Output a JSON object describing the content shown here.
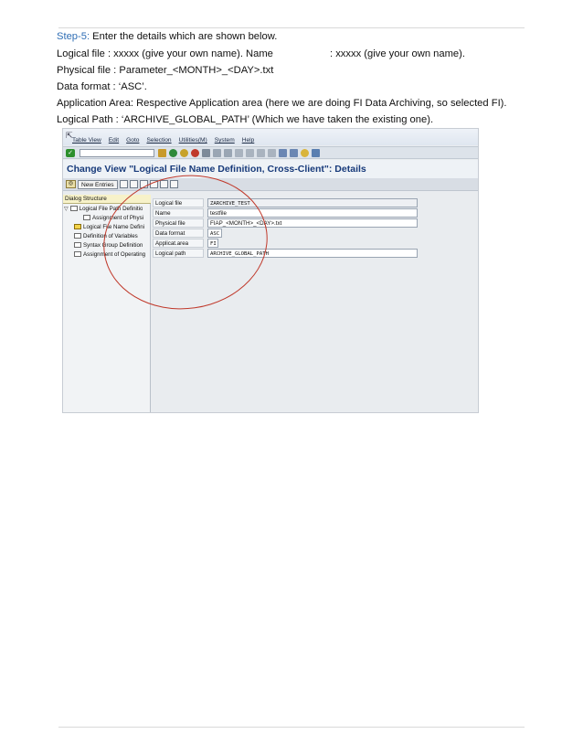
{
  "instructions": {
    "step_label": "Step-5:",
    "step_text": " Enter the details which are shown below.",
    "logical_file_line": "Logical file    : xxxxx (give your own name). Name",
    "name_value": ": xxxxx (give your own name).",
    "physical_file_line": "Physical file  : Parameter_<MONTH>_<DAY>.txt",
    "data_format_line": "Data format   : ‘ASC’.",
    "application_area_line": "Application Area: Respective Application area (here we are doing FI Data Archiving, so selected FI).",
    "logical_path_line": "Logical Path   : ‘ARCHIVE_GLOBAL_PATH’ (Which we have taken the existing one)."
  },
  "sap": {
    "menu": [
      "Table View",
      "Edit",
      "Goto",
      "Selection",
      "Utilities(M)",
      "System",
      "Help"
    ],
    "title": "Change View \"Logical File Name Definition, Cross-Client\": Details",
    "new_entries_label": "New Entries",
    "tree": {
      "header": "Dialog Structure",
      "items": [
        "Logical File Path Definitio",
        "Assignment of Physi",
        "Logical File Name Defini",
        "Definition of Variables",
        "Syntax Group Definition",
        "Assignment of Operating"
      ]
    },
    "fields": [
      {
        "label": "Logical file",
        "value": "ZARCHIVE_TEST"
      },
      {
        "label": "Name",
        "value": "testfile"
      },
      {
        "label": "Physical file",
        "value": "FIAP_<MONTH>_<DAY>.txt"
      },
      {
        "label": "Data format",
        "value": "ASC"
      },
      {
        "label": "Applicat.area",
        "value": "FI"
      },
      {
        "label": "Logical path",
        "value": "ARCHIVE_GLOBAL_PATH"
      }
    ],
    "colors": {
      "title": "#173a7a",
      "circle": "#c0392b",
      "ok_button": "#2d8f2d"
    },
    "icons": [
      "ok-check-icon",
      "save-icon",
      "back-icon",
      "exit-icon",
      "cancel-icon",
      "print-icon",
      "find-icon",
      "glasses-icon"
    ]
  }
}
